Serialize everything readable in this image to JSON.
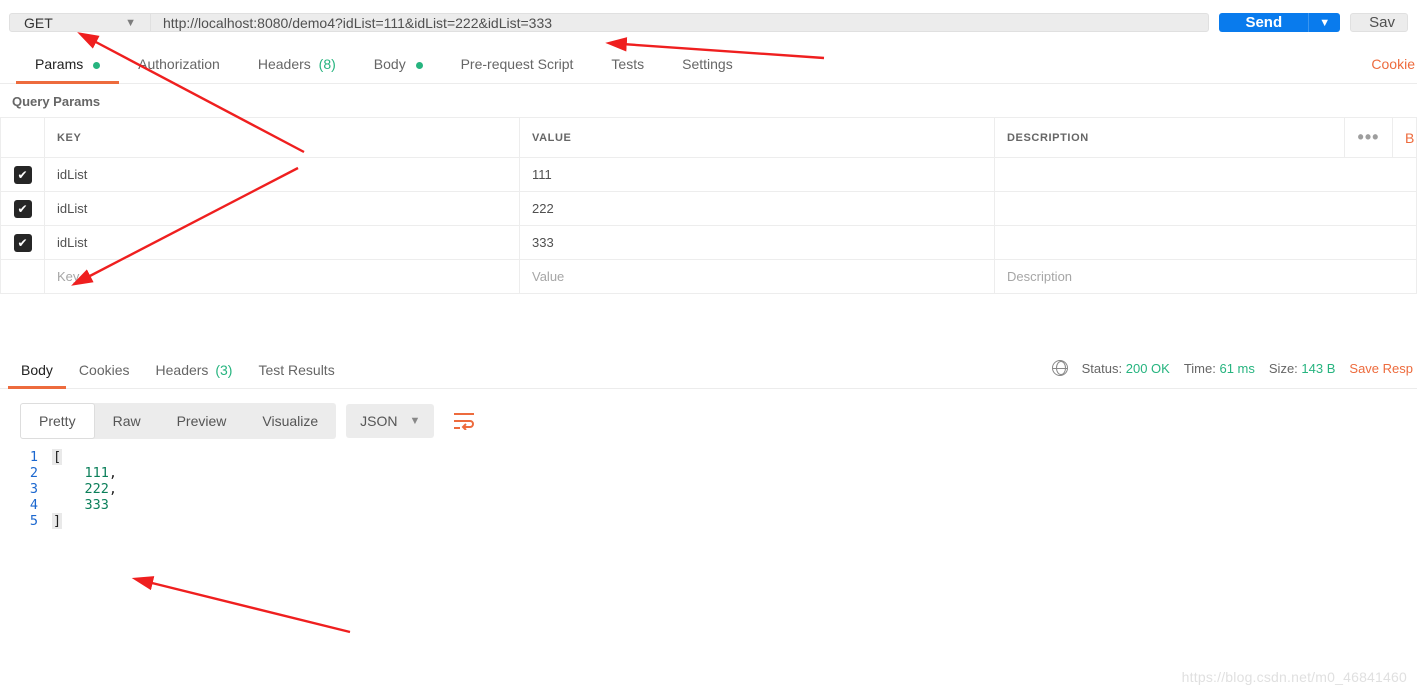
{
  "request": {
    "method": "GET",
    "url": "http://localhost:8080/demo4?idList=111&idList=222&idList=333",
    "send_label": "Send",
    "save_label": "Sav"
  },
  "tabs": {
    "params": "Params",
    "authorization": "Authorization",
    "headers": "Headers",
    "headers_count": "(8)",
    "body": "Body",
    "prerequest": "Pre-request Script",
    "tests": "Tests",
    "settings": "Settings",
    "cookies": "Cookie"
  },
  "params_section": {
    "title": "Query Params",
    "head_key": "KEY",
    "head_value": "VALUE",
    "head_desc": "DESCRIPTION",
    "bulk": "B",
    "rows": [
      {
        "key": "idList",
        "value": "111",
        "desc": ""
      },
      {
        "key": "idList",
        "value": "222",
        "desc": ""
      },
      {
        "key": "idList",
        "value": "333",
        "desc": ""
      }
    ],
    "ph_key": "Key",
    "ph_value": "Value",
    "ph_desc": "Description"
  },
  "resp_tabs": {
    "body": "Body",
    "cookies": "Cookies",
    "headers": "Headers",
    "headers_count": "(3)",
    "tests": "Test Results"
  },
  "resp_meta": {
    "status_label": "Status:",
    "status_value": "200 OK",
    "time_label": "Time:",
    "time_value": "61 ms",
    "size_label": "Size:",
    "size_value": "143 B",
    "save_response": "Save Resp"
  },
  "body_view": {
    "pretty": "Pretty",
    "raw": "Raw",
    "preview": "Preview",
    "visualize": "Visualize",
    "format": "JSON"
  },
  "response_body": {
    "lines": [
      {
        "n": "1",
        "indent": "",
        "text": "[",
        "kind": "brkt"
      },
      {
        "n": "2",
        "indent": "    ",
        "text": "111",
        "kind": "num",
        "trail": ","
      },
      {
        "n": "3",
        "indent": "    ",
        "text": "222",
        "kind": "num",
        "trail": ","
      },
      {
        "n": "4",
        "indent": "    ",
        "text": "333",
        "kind": "num",
        "trail": ""
      },
      {
        "n": "5",
        "indent": "",
        "text": "]",
        "kind": "brkt"
      }
    ]
  },
  "watermark": "https://blog.csdn.net/m0_46841460"
}
